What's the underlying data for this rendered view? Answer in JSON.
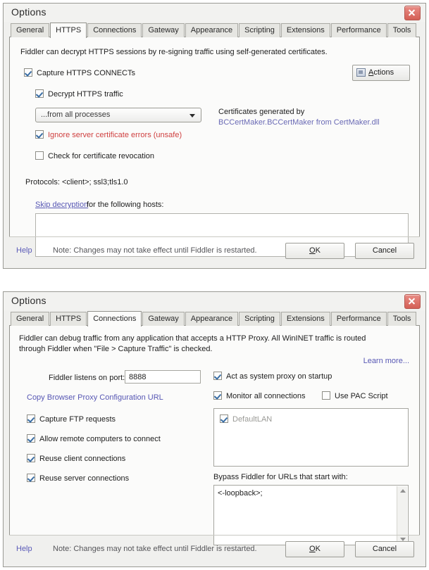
{
  "dialog_https": {
    "title": "Options",
    "close_icon": "close-icon",
    "tabs": [
      {
        "label": "General",
        "selected": false
      },
      {
        "label": "HTTPS",
        "selected": true
      },
      {
        "label": "Connections",
        "selected": false
      },
      {
        "label": "Gateway",
        "selected": false
      },
      {
        "label": "Appearance",
        "selected": false
      },
      {
        "label": "Scripting",
        "selected": false
      },
      {
        "label": "Extensions",
        "selected": false
      },
      {
        "label": "Performance",
        "selected": false
      },
      {
        "label": "Tools",
        "selected": false
      }
    ],
    "description": "Fiddler can decrypt HTTPS sessions by re-signing traffic using self-generated certificates.",
    "capture_connects": {
      "label": "Capture HTTPS CONNECTs",
      "checked": true
    },
    "decrypt_traffic": {
      "label": "Decrypt HTTPS traffic",
      "checked": true
    },
    "process_filter": {
      "value": "...from all processes"
    },
    "ignore_cert_errors": {
      "label": "Ignore server certificate errors (unsafe)",
      "checked": true
    },
    "check_revocation": {
      "label": "Check for certificate revocation",
      "checked": false
    },
    "protocols_label": "Protocols: <client>; ssl3;tls1.0",
    "skip_link": "Skip decryption",
    "skip_suffix": "for the following hosts:",
    "skip_hosts_value": "",
    "actions_button": "Actions",
    "certificates_line1": "Certificates generated by",
    "certificates_line2": "BCCertMaker.BCCertMaker from CertMaker.dll",
    "footer": {
      "help": "Help",
      "note": "Note: Changes may not take effect until Fiddler is restarted.",
      "ok": "OK",
      "cancel": "Cancel"
    }
  },
  "dialog_connections": {
    "title": "Options",
    "close_icon": "close-icon",
    "tabs": [
      {
        "label": "General",
        "selected": false
      },
      {
        "label": "HTTPS",
        "selected": false
      },
      {
        "label": "Connections",
        "selected": true
      },
      {
        "label": "Gateway",
        "selected": false
      },
      {
        "label": "Appearance",
        "selected": false
      },
      {
        "label": "Scripting",
        "selected": false
      },
      {
        "label": "Extensions",
        "selected": false
      },
      {
        "label": "Performance",
        "selected": false
      },
      {
        "label": "Tools",
        "selected": false
      }
    ],
    "description_line1": "Fiddler can debug traffic from any application that accepts a HTTP Proxy. All WinINET traffic is routed",
    "description_line2": "through Fiddler when \"File > Capture Traffic\" is checked.",
    "learn_more": "Learn more...",
    "port_label": "Fiddler listens on port:",
    "port_value": "8888",
    "copy_proxy_url": "Copy Browser Proxy Configuration URL",
    "capture_ftp": {
      "label": "Capture FTP requests",
      "checked": true
    },
    "allow_remote": {
      "label": "Allow remote computers to connect",
      "checked": true
    },
    "reuse_client": {
      "label": "Reuse client connections",
      "checked": true
    },
    "reuse_server": {
      "label": "Reuse server connections",
      "checked": true
    },
    "act_as_proxy": {
      "label": "Act as system proxy on startup",
      "checked": true
    },
    "monitor_all": {
      "label": "Monitor all connections",
      "checked": true
    },
    "use_pac_script": {
      "label": "Use PAC Script",
      "checked": false
    },
    "connection_list": [
      {
        "label": "DefaultLAN",
        "checked": true,
        "disabled": true
      }
    ],
    "bypass_label": "Bypass Fiddler for URLs that start with:",
    "bypass_value": "<-loopback>;",
    "footer": {
      "help": "Help",
      "note": "Note: Changes may not take effect until Fiddler is restarted.",
      "ok": "OK",
      "cancel": "Cancel"
    }
  }
}
